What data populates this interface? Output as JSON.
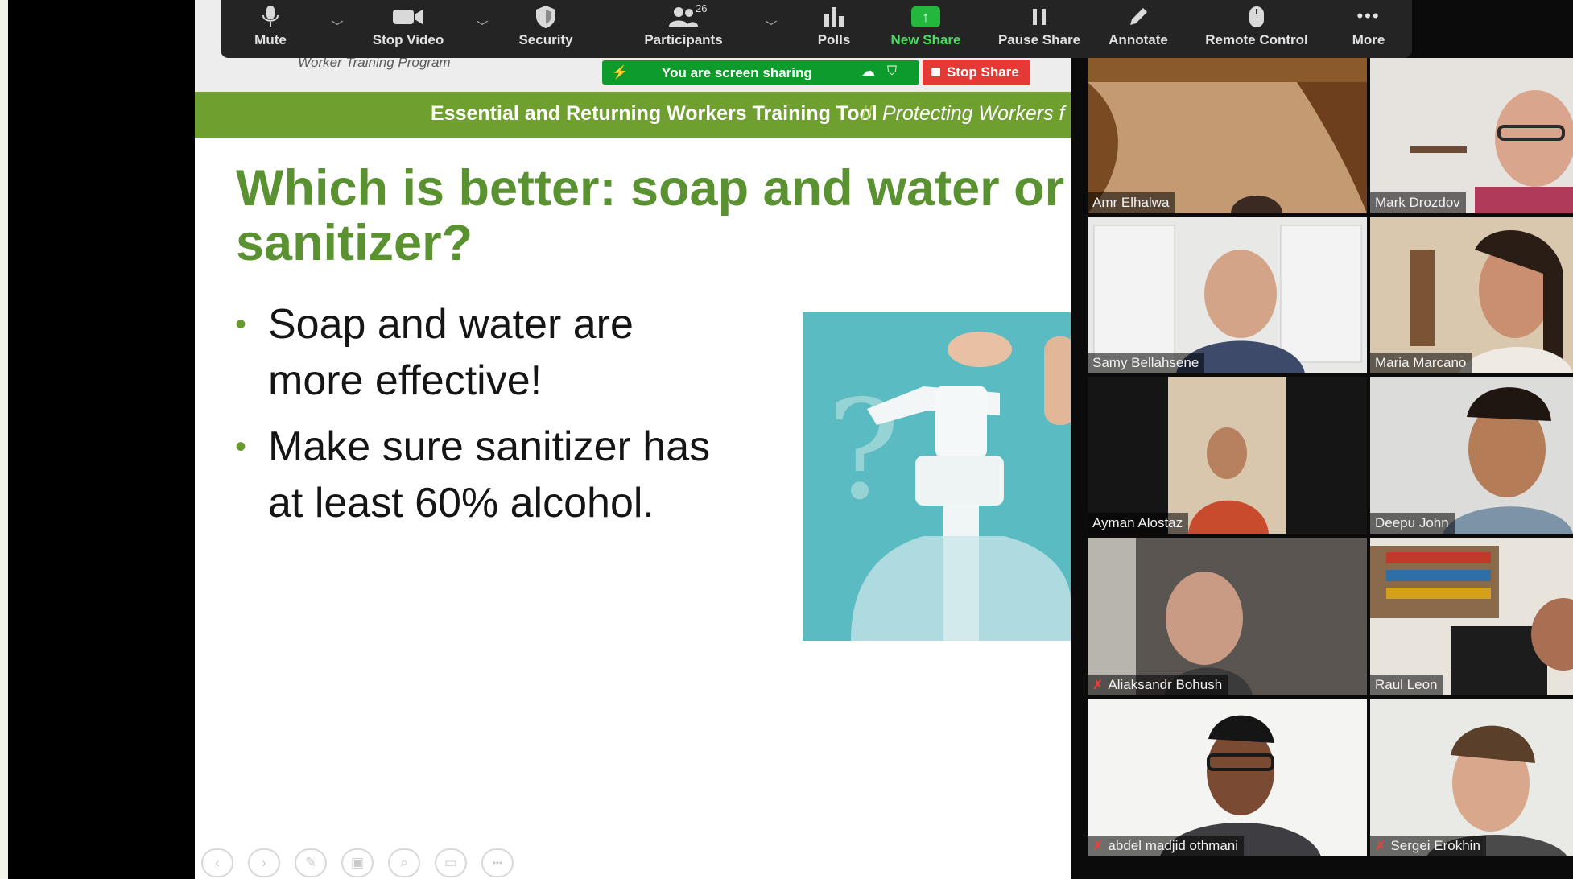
{
  "toolbar": {
    "mute": "Mute",
    "stop_video": "Stop Video",
    "security": "Security",
    "participants": "Participants",
    "participants_count": "26",
    "polls": "Polls",
    "new_share": "New Share",
    "pause_share": "Pause Share",
    "annotate": "Annotate",
    "remote_control": "Remote Control",
    "more": "More"
  },
  "sharing": {
    "status": "You are screen sharing",
    "stop_label": "Stop Share"
  },
  "slide": {
    "caption": "Worker Training Program",
    "band_main": "Essential and Returning Workers Training Tool",
    "band_separator": "//",
    "band_sub": "Protecting Workers f",
    "title": "Which is better: soap and water or sanitizer?",
    "bullets": [
      "Soap and water are more effective!",
      "Make sure sanitizer has at least 60% alcohol."
    ],
    "controls": [
      "‹",
      "›",
      "✎",
      "▣",
      "⌕",
      "▭",
      "•••"
    ]
  },
  "participants": [
    {
      "name": "Amr Elhalwa",
      "muted": false
    },
    {
      "name": "Mark Drozdov",
      "muted": false
    },
    {
      "name": "Samy Bellahsene",
      "muted": false
    },
    {
      "name": "Maria Marcano",
      "muted": false
    },
    {
      "name": "Ayman Alostaz",
      "muted": false
    },
    {
      "name": "Deepu John",
      "muted": false
    },
    {
      "name": "Aliaksandr Bohush",
      "muted": true
    },
    {
      "name": "Raul Leon",
      "muted": false
    },
    {
      "name": "abdel madjid othmani",
      "muted": true
    },
    {
      "name": "Sergei Erokhin",
      "muted": true
    }
  ],
  "colors": {
    "slide_green": "#5b9231",
    "band_green": "#6f9f2f",
    "share_green": "#0d9b2c",
    "stop_red": "#e53935",
    "toolbar": "#242424"
  },
  "icons": {
    "mute": "microphone-icon",
    "stop_video": "video-camera-icon",
    "security": "shield-icon",
    "participants": "people-icon",
    "polls": "bar-chart-icon",
    "new_share": "share-arrow-icon",
    "pause_share": "pause-icon",
    "annotate": "pencil-icon",
    "remote_control": "mouse-icon",
    "more": "more-dots-icon"
  }
}
